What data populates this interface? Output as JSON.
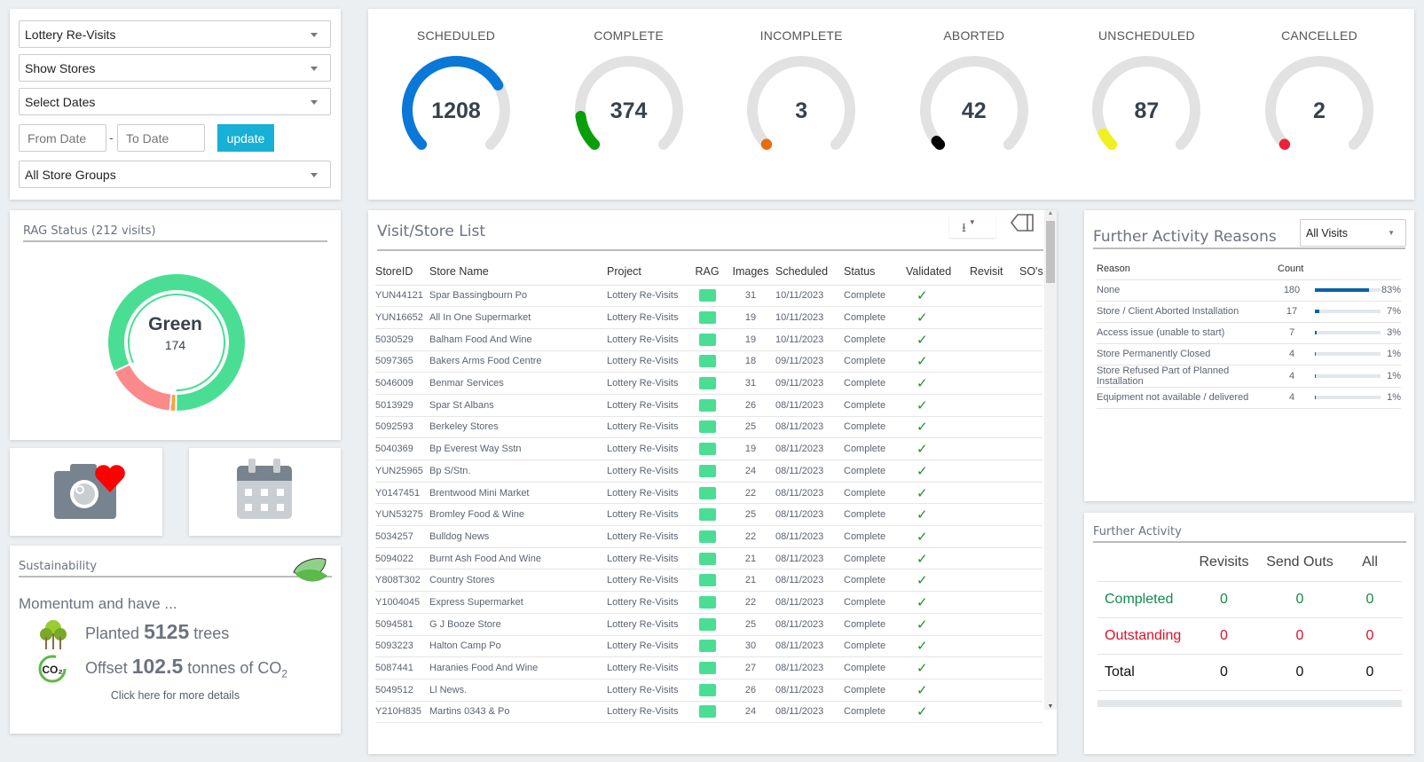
{
  "filters": {
    "project": "Lottery Re-Visits",
    "stores": "Show Stores",
    "dates": "Select Dates",
    "from_placeholder": "From Date",
    "to_placeholder": "To Date",
    "separator": "-",
    "update_label": "update",
    "groups": "All Store Groups"
  },
  "gauges": [
    {
      "label": "SCHEDULED",
      "value": "1208",
      "level": 0.72,
      "color": "#0a78d8"
    },
    {
      "label": "COMPLETE",
      "value": "374",
      "level": 0.14,
      "color": "#0a9e0a"
    },
    {
      "label": "INCOMPLETE",
      "value": "3",
      "level": 0,
      "color": "#e86c0a"
    },
    {
      "label": "ABORTED",
      "value": "42",
      "level": 0.02,
      "color": "#000000"
    },
    {
      "label": "UNSCHEDULED",
      "value": "87",
      "level": 0.06,
      "color": "#f0f020"
    },
    {
      "label": "CANCELLED",
      "value": "2",
      "level": 0,
      "color": "#f0203a"
    }
  ],
  "rag": {
    "title": "RAG Status (212 visits)",
    "center_label": "Green",
    "center_value": "174",
    "segments": [
      {
        "name": "Red",
        "value": 35,
        "color": "#fd8a8a"
      },
      {
        "name": "Amber",
        "value": 3,
        "color": "#fba040"
      },
      {
        "name": "Green",
        "value": 174,
        "color": "#4ade94"
      }
    ]
  },
  "tiles": {
    "photos_icon": "camera-heart-icon",
    "calendar_icon": "calendar-icon"
  },
  "sustainability": {
    "title": "Sustainability",
    "intro": "Momentum and have ...",
    "planted_prefix": "Planted",
    "planted_value": "5125",
    "planted_suffix": "trees",
    "offset_prefix": "Offset",
    "offset_value": "102.5",
    "offset_suffix": "tonnes of CO",
    "offset_sub": "2",
    "link": "Click here for more details"
  },
  "visits": {
    "title": "Visit/Store List",
    "columns": [
      "StoreID",
      "Store Name",
      "Project",
      "RAG",
      "Images",
      "Scheduled",
      "Status",
      "Validated",
      "Revisit",
      "SO's"
    ],
    "rows": [
      [
        "YUN44121",
        "Spar Bassingbourn Po",
        "Lottery Re-Visits",
        "green",
        "31",
        "10/11/2023",
        "Complete",
        true
      ],
      [
        "YUN16652",
        "All In One Supermarket",
        "Lottery Re-Visits",
        "green",
        "19",
        "10/11/2023",
        "Complete",
        true
      ],
      [
        "5030529",
        "Balham Food And Wine",
        "Lottery Re-Visits",
        "green",
        "19",
        "10/11/2023",
        "Complete",
        true
      ],
      [
        "5097365",
        "Bakers Arms Food Centre",
        "Lottery Re-Visits",
        "green",
        "18",
        "09/11/2023",
        "Complete",
        true
      ],
      [
        "5046009",
        "Benmar Services",
        "Lottery Re-Visits",
        "green",
        "31",
        "09/11/2023",
        "Complete",
        true
      ],
      [
        "5013929",
        "Spar St Albans",
        "Lottery Re-Visits",
        "green",
        "26",
        "08/11/2023",
        "Complete",
        true
      ],
      [
        "5092593",
        "Berkeley Stores",
        "Lottery Re-Visits",
        "green",
        "25",
        "08/11/2023",
        "Complete",
        true
      ],
      [
        "5040369",
        "Bp Everest Way Sstn",
        "Lottery Re-Visits",
        "green",
        "19",
        "08/11/2023",
        "Complete",
        true
      ],
      [
        "YUN25965",
        "Bp S/Stn.",
        "Lottery Re-Visits",
        "green",
        "24",
        "08/11/2023",
        "Complete",
        true
      ],
      [
        "Y0147451",
        "Brentwood Mini Market",
        "Lottery Re-Visits",
        "green",
        "22",
        "08/11/2023",
        "Complete",
        true
      ],
      [
        "YUN53275",
        "Bromley Food & Wine",
        "Lottery Re-Visits",
        "green",
        "25",
        "08/11/2023",
        "Complete",
        true
      ],
      [
        "5034257",
        "Bulldog News",
        "Lottery Re-Visits",
        "green",
        "22",
        "08/11/2023",
        "Complete",
        true
      ],
      [
        "5094022",
        "Burnt Ash Food And Wine",
        "Lottery Re-Visits",
        "green",
        "21",
        "08/11/2023",
        "Complete",
        true
      ],
      [
        "Y808T302",
        "Country Stores",
        "Lottery Re-Visits",
        "green",
        "21",
        "08/11/2023",
        "Complete",
        true
      ],
      [
        "Y1004045",
        "Express Supermarket",
        "Lottery Re-Visits",
        "green",
        "22",
        "08/11/2023",
        "Complete",
        true
      ],
      [
        "5094581",
        "G J Booze Store",
        "Lottery Re-Visits",
        "green",
        "25",
        "08/11/2023",
        "Complete",
        true
      ],
      [
        "5093223",
        "Halton Camp Po",
        "Lottery Re-Visits",
        "green",
        "30",
        "08/11/2023",
        "Complete",
        true
      ],
      [
        "5087441",
        "Haranies Food And Wine",
        "Lottery Re-Visits",
        "green",
        "27",
        "08/11/2023",
        "Complete",
        true
      ],
      [
        "5049512",
        "Ll News.",
        "Lottery Re-Visits",
        "green",
        "26",
        "08/11/2023",
        "Complete",
        true
      ],
      [
        "Y210H835",
        "Martins 0343 & Po",
        "Lottery Re-Visits",
        "green",
        "24",
        "08/11/2023",
        "Complete",
        true
      ]
    ],
    "rag_color": "#4ade94",
    "check": "✓"
  },
  "reasons": {
    "title": "Further Activity Reasons",
    "filter": "All Visits",
    "col_reason": "Reason",
    "col_count": "Count",
    "rows": [
      {
        "reason": "None",
        "count": "180",
        "pct": "83%",
        "level": 0.83
      },
      {
        "reason": "Store / Client Aborted Installation",
        "count": "17",
        "pct": "7%",
        "level": 0.07
      },
      {
        "reason": "Access issue (unable to start)",
        "count": "7",
        "pct": "3%",
        "level": 0.03
      },
      {
        "reason": "Store Permanently Closed",
        "count": "4",
        "pct": "1%",
        "level": 0.01
      },
      {
        "reason": "Store Refused Part of Planned Installation",
        "count": "4",
        "pct": "1%",
        "level": 0.01
      },
      {
        "reason": "Equipment not available / delivered",
        "count": "4",
        "pct": "1%",
        "level": 0.01
      }
    ]
  },
  "activity": {
    "title": "Further Activity",
    "columns": [
      "Revisits",
      "Send Outs",
      "All"
    ],
    "rows": [
      {
        "label": "Completed",
        "values": [
          "0",
          "0",
          "0"
        ],
        "color": "#138a4a"
      },
      {
        "label": "Outstanding",
        "values": [
          "0",
          "0",
          "0"
        ],
        "color": "#e0102a"
      },
      {
        "label": "Total",
        "values": [
          "0",
          "0",
          "0"
        ],
        "color": "#111111"
      }
    ]
  }
}
